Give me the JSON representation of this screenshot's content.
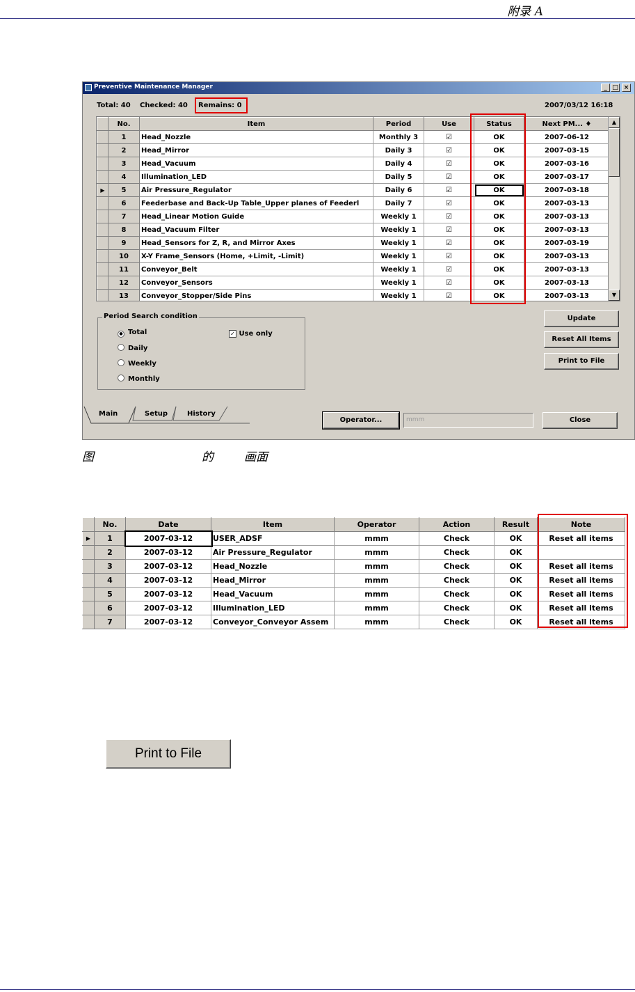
{
  "page_header": {
    "text": "附录 A"
  },
  "window": {
    "title": "Preventive Maintenance Manager",
    "controls": [
      "_",
      "□",
      "×"
    ],
    "summary": {
      "total": "Total: 40",
      "checked": "Checked: 40",
      "remains": "Remains: 0",
      "datetime": "2007/03/12 16:18"
    },
    "table": {
      "headers": [
        "No.",
        "Item",
        "Period",
        "Use",
        "Status",
        "Next PM... ♦"
      ],
      "rows": [
        {
          "no": "1",
          "item": "Head_Nozzle",
          "period": "Monthly 3",
          "use": "☑",
          "status": "OK",
          "next": "2007-06-12"
        },
        {
          "no": "2",
          "item": "Head_Mirror",
          "period": "Daily 3",
          "use": "☑",
          "status": "OK",
          "next": "2007-03-15"
        },
        {
          "no": "3",
          "item": "Head_Vacuum",
          "period": "Daily 4",
          "use": "☑",
          "status": "OK",
          "next": "2007-03-16"
        },
        {
          "no": "4",
          "item": "Illumination_LED",
          "period": "Daily 5",
          "use": "☑",
          "status": "OK",
          "next": "2007-03-17"
        },
        {
          "no": "5",
          "item": "Air Pressure_Regulator",
          "period": "Daily 6",
          "use": "☑",
          "status": "OK",
          "next": "2007-03-18"
        },
        {
          "no": "6",
          "item": "Feederbase and Back-Up Table_Upper planes of Feederl",
          "period": "Daily 7",
          "use": "☑",
          "status": "OK",
          "next": "2007-03-13"
        },
        {
          "no": "7",
          "item": "Head_Linear Motion Guide",
          "period": "Weekly 1",
          "use": "☑",
          "status": "OK",
          "next": "2007-03-13"
        },
        {
          "no": "8",
          "item": "Head_Vacuum Filter",
          "period": "Weekly 1",
          "use": "☑",
          "status": "OK",
          "next": "2007-03-13"
        },
        {
          "no": "9",
          "item": "Head_Sensors for Z, R, and Mirror Axes",
          "period": "Weekly 1",
          "use": "☑",
          "status": "OK",
          "next": "2007-03-19"
        },
        {
          "no": "10",
          "item": "X-Y Frame_Sensors (Home, +Limit, -Limit)",
          "period": "Weekly 1",
          "use": "☑",
          "status": "OK",
          "next": "2007-03-13"
        },
        {
          "no": "11",
          "item": "Conveyor_Belt",
          "period": "Weekly 1",
          "use": "☑",
          "status": "OK",
          "next": "2007-03-13"
        },
        {
          "no": "12",
          "item": "Conveyor_Sensors",
          "period": "Weekly 1",
          "use": "☑",
          "status": "OK",
          "next": "2007-03-13"
        },
        {
          "no": "13",
          "item": "Conveyor_Stopper/Side Pins",
          "period": "Weekly 1",
          "use": "☑",
          "status": "OK",
          "next": "2007-03-13"
        }
      ],
      "current_row_marker": "▶"
    },
    "search": {
      "legend": "Period Search condition",
      "options": [
        "Total",
        "Daily",
        "Weekly",
        "Monthly"
      ],
      "selected": "Total",
      "use_only_label": "Use only"
    },
    "buttons": {
      "update": "Update",
      "reset_all": "Reset All Items",
      "print_to_file": "Print to File",
      "operator": "Operator...",
      "close": "Close"
    },
    "operator_value": "mmm",
    "tabs": [
      "Main",
      "Setup",
      "History"
    ]
  },
  "figure_caption": {
    "a": "图",
    "b": "的",
    "c": "画面"
  },
  "history": {
    "headers": [
      "No.",
      "Date",
      "Item",
      "Operator",
      "Action",
      "Result",
      "Note"
    ],
    "rows": [
      {
        "no": "1",
        "date": "2007-03-12",
        "item": "USER_ADSF",
        "operator": "mmm",
        "action": "Check",
        "result": "OK",
        "note": "Reset all items"
      },
      {
        "no": "2",
        "date": "2007-03-12",
        "item": "Air Pressure_Regulator",
        "operator": "mmm",
        "action": "Check",
        "result": "OK",
        "note": ""
      },
      {
        "no": "3",
        "date": "2007-03-12",
        "item": "Head_Nozzle",
        "operator": "mmm",
        "action": "Check",
        "result": "OK",
        "note": "Reset all items"
      },
      {
        "no": "4",
        "date": "2007-03-12",
        "item": "Head_Mirror",
        "operator": "mmm",
        "action": "Check",
        "result": "OK",
        "note": "Reset all items"
      },
      {
        "no": "5",
        "date": "2007-03-12",
        "item": "Head_Vacuum",
        "operator": "mmm",
        "action": "Check",
        "result": "OK",
        "note": "Reset all items"
      },
      {
        "no": "6",
        "date": "2007-03-12",
        "item": "Illumination_LED",
        "operator": "mmm",
        "action": "Check",
        "result": "OK",
        "note": "Reset all items"
      },
      {
        "no": "7",
        "date": "2007-03-12",
        "item": "Conveyor_Conveyor Assem",
        "operator": "mmm",
        "action": "Check",
        "result": "OK",
        "note": "Reset all items"
      }
    ],
    "current_row_marker": "▶"
  },
  "print_button_large": {
    "label": "Print to File"
  },
  "colors": {
    "highlight_red": "#e00000",
    "title_blue": "#0a246a",
    "window_gray": "#d4d0c8"
  }
}
